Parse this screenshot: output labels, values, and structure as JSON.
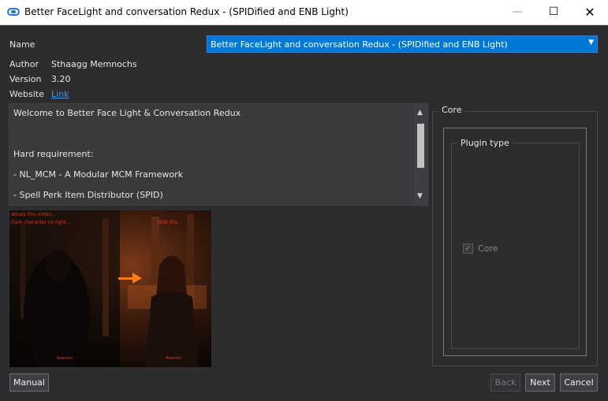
{
  "window": {
    "title": "Better FaceLight and conversation Redux - (SPIDified and ENB Light)",
    "minimize_glyph": "—",
    "maximize_glyph": "☐",
    "close_glyph": "✕"
  },
  "info": {
    "name_label": "Name",
    "name_value": "Better FaceLight and conversation Redux - (SPIDified and ENB Light)",
    "author_label": "Author",
    "author_value": "Sthaagg Memnochs",
    "version_label": "Version",
    "version_value": "3.20",
    "website_label": "Website",
    "website_link": "Link"
  },
  "description": {
    "lines": [
      "Welcome to Better Face Light & Conversation Redux",
      "",
      "Hard requirement:",
      "- NL_MCM - A Modular MCM Framework",
      "- Spell Perk Item Distributor (SPID)"
    ]
  },
  "preview": {
    "caption_top_lines": [
      "Whats this notbo...",
      "Dark character no light..."
    ],
    "caption_right": "With the...",
    "caption_bottom_left": "Reenhin",
    "caption_bottom_right": "Reenhin"
  },
  "options": {
    "group_title": "Core",
    "plugin_type_title": "Plugin type",
    "core_option_label": "Core",
    "core_option_checked": true
  },
  "buttons": {
    "manual": "Manual",
    "back": "Back",
    "next": "Next",
    "cancel": "Cancel"
  },
  "colors": {
    "accent": "#0078d7",
    "background": "#2d2d30",
    "link": "#3f94e6"
  }
}
